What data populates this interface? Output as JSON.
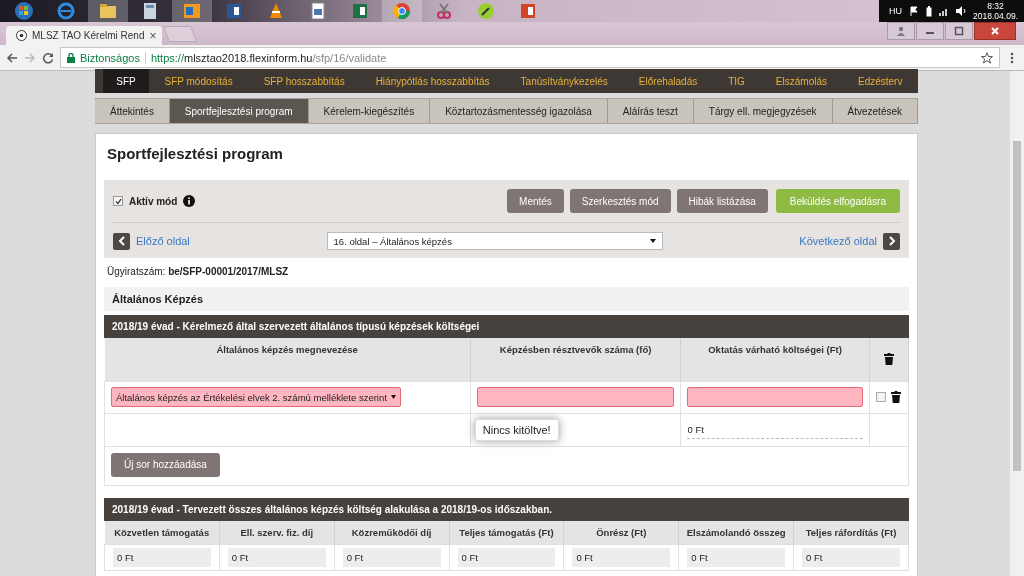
{
  "tray": {
    "language": "HU",
    "time": "8:32",
    "date": "2018.04.09."
  },
  "browser": {
    "tab_title": "MLSZ TAO Kérelmi Rend",
    "tab_close": "×",
    "security": "Biztonságos",
    "url_scheme": "https://",
    "url_host": "mlsztao2018.flexinform.hu",
    "url_path": "/sfp/16/validate"
  },
  "nav_primary": [
    {
      "label": "SFP",
      "selected": true
    },
    {
      "label": "SFP módosítás",
      "selected": false
    },
    {
      "label": "SFP hosszabbítás",
      "selected": false
    },
    {
      "label": "Hiánypótlás hosszabbítás",
      "selected": false
    },
    {
      "label": "Tanúsítványkezelés",
      "selected": false
    },
    {
      "label": "Előrehaladás",
      "selected": false
    },
    {
      "label": "TIG",
      "selected": false
    },
    {
      "label": "Elszámolás",
      "selected": false
    },
    {
      "label": "Edzésterv",
      "selected": false
    }
  ],
  "nav_secondary": [
    {
      "label": "Áttekintés",
      "selected": false
    },
    {
      "label": "Sportfejlesztési program",
      "selected": true
    },
    {
      "label": "Kérelem-kiegészítés",
      "selected": false
    },
    {
      "label": "Köztartozásmentesség igazolása",
      "selected": false
    },
    {
      "label": "Aláírás teszt",
      "selected": false
    },
    {
      "label": "Tárgy ell. megjegyzések",
      "selected": false
    },
    {
      "label": "Átvezetések",
      "selected": false
    }
  ],
  "page_title": "Sportfejlesztési program",
  "active_mode": {
    "label": "Aktív mód",
    "checked": true
  },
  "buttons": [
    {
      "label": "Mentés",
      "kind": "secondary"
    },
    {
      "label": "Szerkesztés mód",
      "kind": "secondary"
    },
    {
      "label": "Hibák listázása",
      "kind": "secondary"
    },
    {
      "label": "Beküldés elfogadásra",
      "kind": "primary"
    }
  ],
  "prev_link": "Előző oldal",
  "page_select": "16. oldal – Általános képzés",
  "next_link": "Következő oldal",
  "case_number": {
    "label": "Ügyiratszám:",
    "value": "be/SFP-00001/2017/MLSZ"
  },
  "section_title": "Általános Képzés",
  "table1": {
    "title": "2018/19 évad - Kérelmező által szervezett általános típusú képzések költségei",
    "columns": [
      "Általános képzés megnevezése",
      "Képzésben résztvevők száma (fő)",
      "Oktatás várható költségei (Ft)"
    ],
    "rows": [
      {
        "training": "Általános képzés az Értékelési elvek 2. számú melléklete szerint",
        "invalid": true,
        "checked": false
      }
    ],
    "tooltip": "Nincs kitöltve!",
    "total": "0 Ft",
    "add_row_button": "Új sor hozzáadása"
  },
  "table2": {
    "title": "2018/19 évad - Tervezett összes általános képzés költség alakulása a 2018/19-os időszakban.",
    "columns": [
      "Közvetlen támogatás",
      "Ell. szerv. fiz. díj",
      "Közreműködői díj",
      "Teljes támogatás (Ft)",
      "Önrész (Ft)",
      "Elszámolandó összeg",
      "Teljes ráfordítás (Ft)"
    ],
    "values": [
      "0 Ft",
      "0 Ft",
      "0 Ft",
      "0 Ft",
      "0 Ft",
      "0 Ft",
      "0 Ft"
    ]
  }
}
